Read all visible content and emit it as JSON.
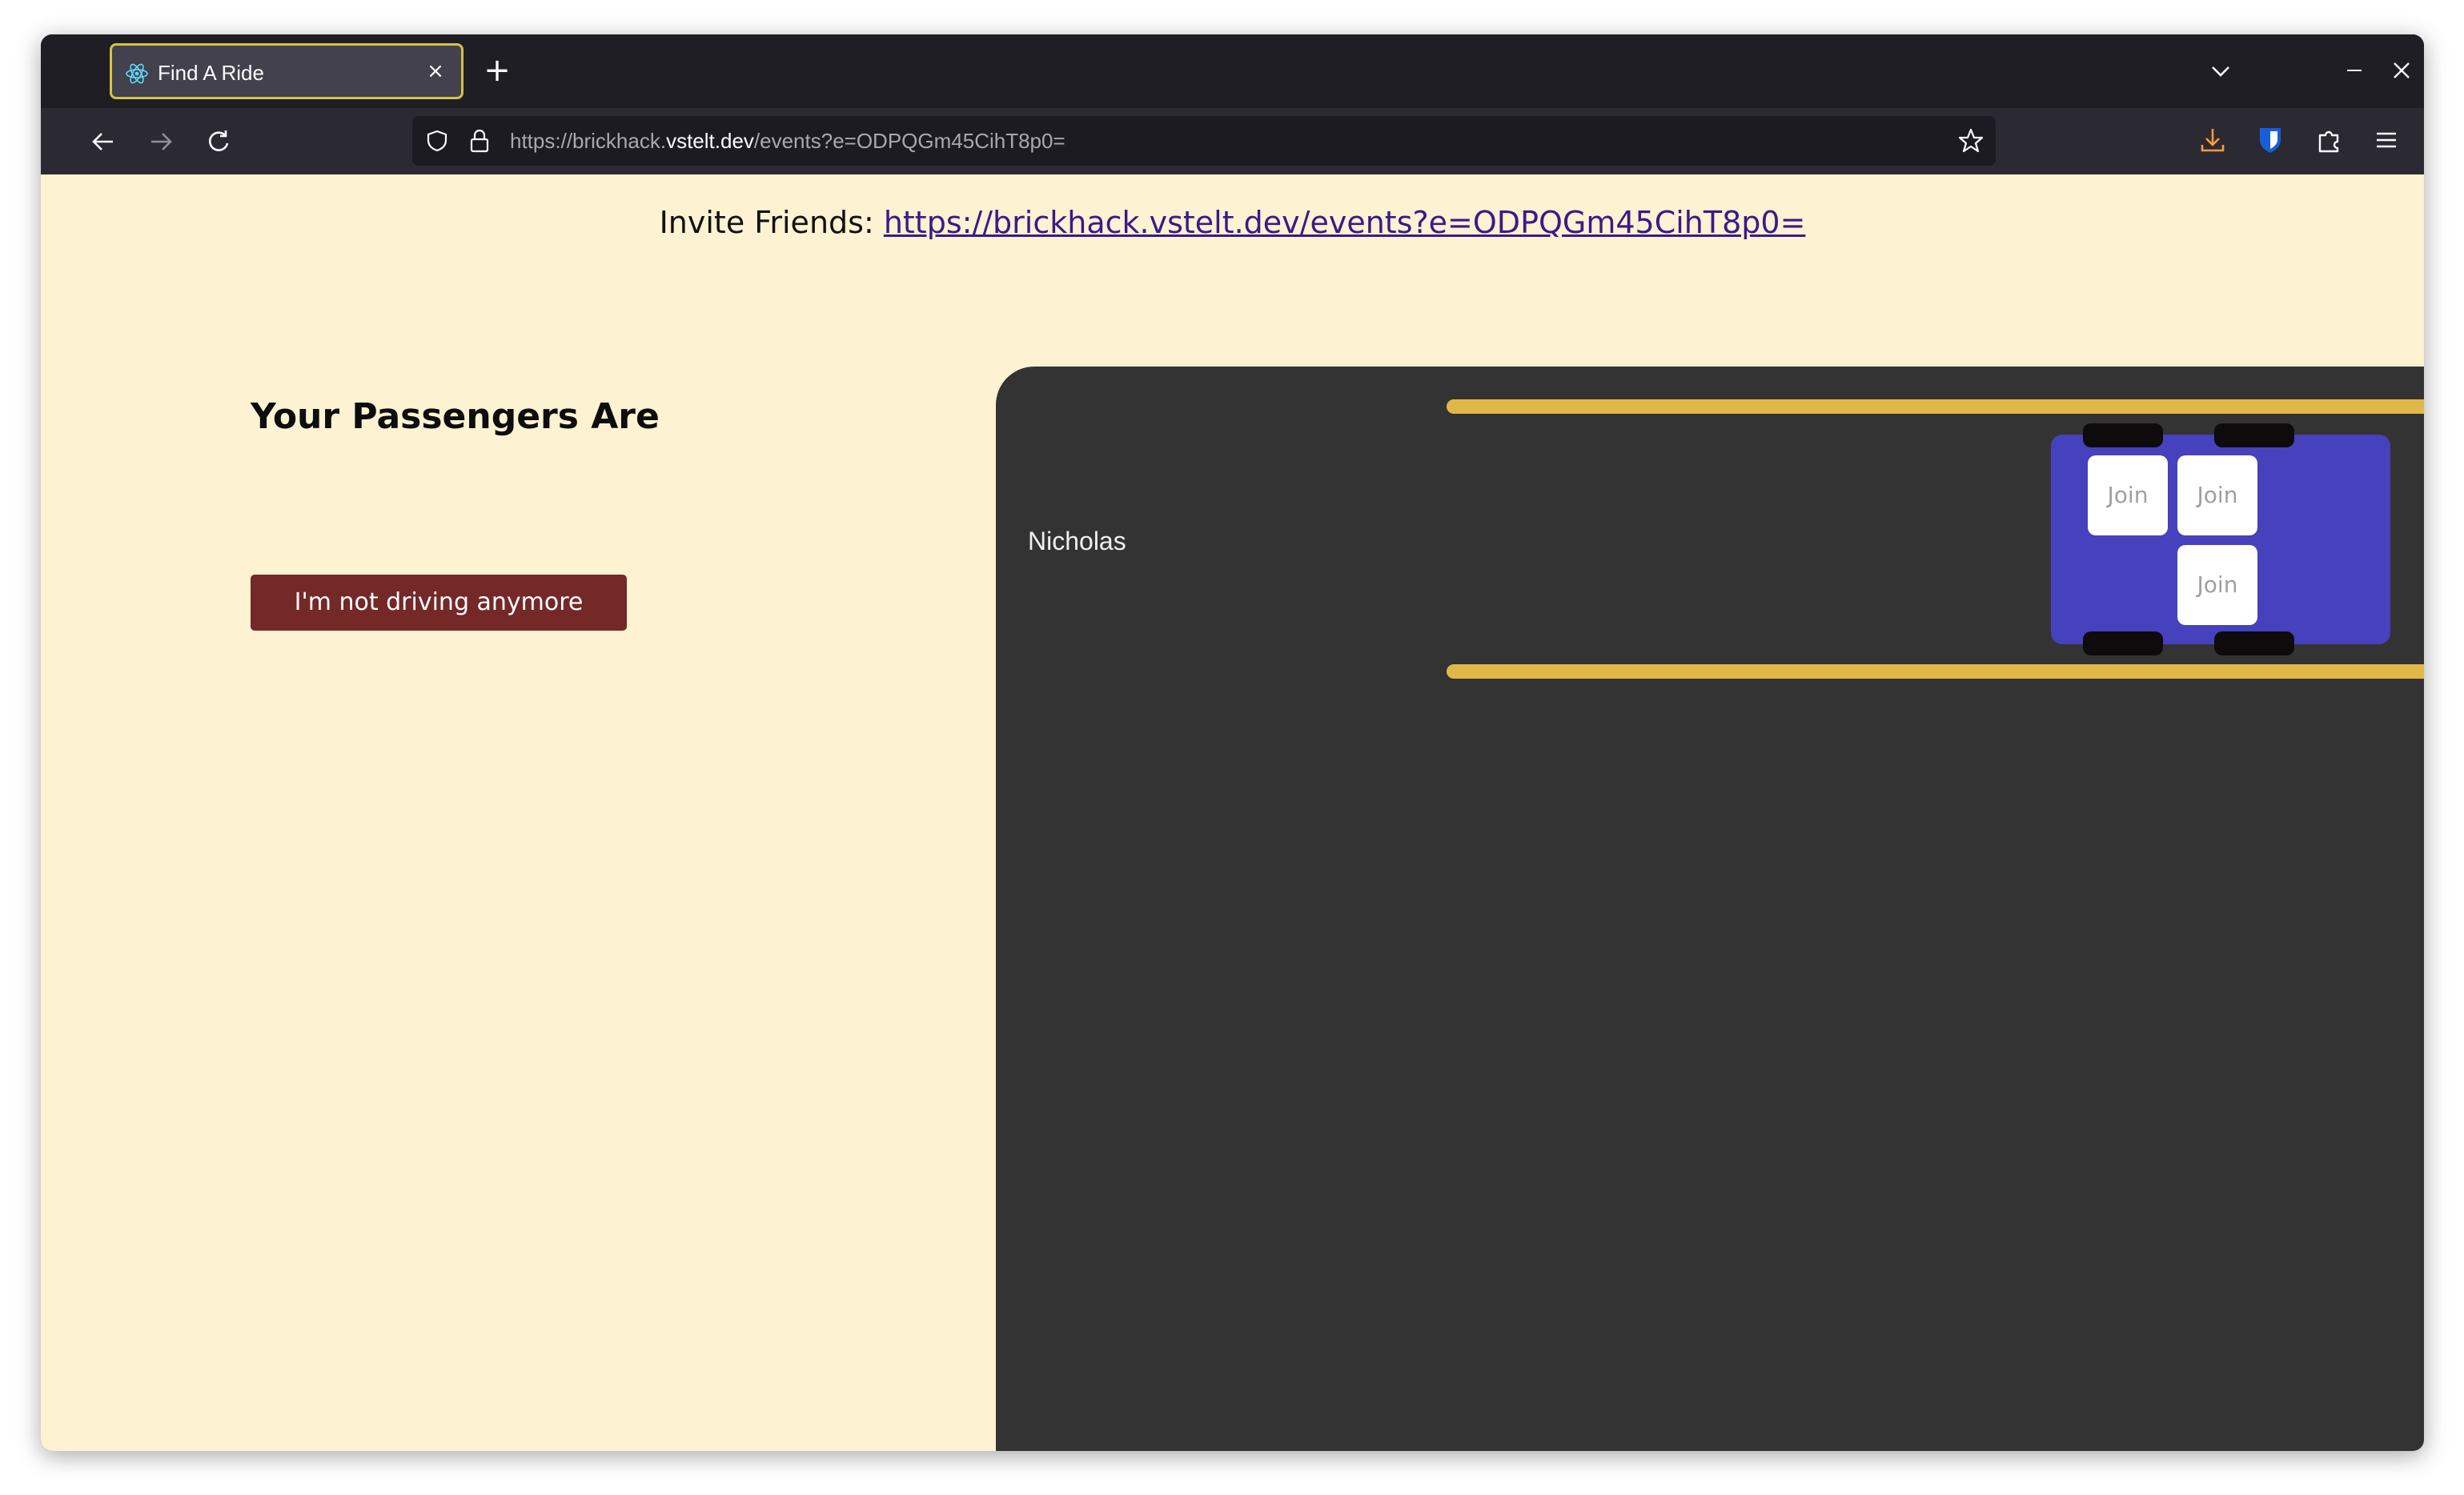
{
  "browser": {
    "tab": {
      "title": "Find A Ride",
      "close_symbol": "×"
    },
    "new_tab_symbol": "+",
    "url": {
      "prefix": "https://brickhack.",
      "domain": "vstelt.dev",
      "path": "/events?e=ODPQGm45CihT8p0="
    }
  },
  "page": {
    "invite_label": "Invite Friends: ",
    "invite_link": "https://brickhack.vstelt.dev/events?e=ODPQGm45CihT8p0=",
    "heading": "Your Passengers Are",
    "stop_driving_button": "I'm not driving anymore"
  },
  "ride": {
    "driver_name": "Nicholas",
    "seats": [
      {
        "label": "Join"
      },
      {
        "label": "Join"
      },
      {
        "label": "Join"
      }
    ],
    "colors": {
      "car": "#4641bc",
      "lane": "#e0b84a",
      "panel": "#333333",
      "button": "#742828",
      "page_bg": "#fdf2d1"
    }
  }
}
